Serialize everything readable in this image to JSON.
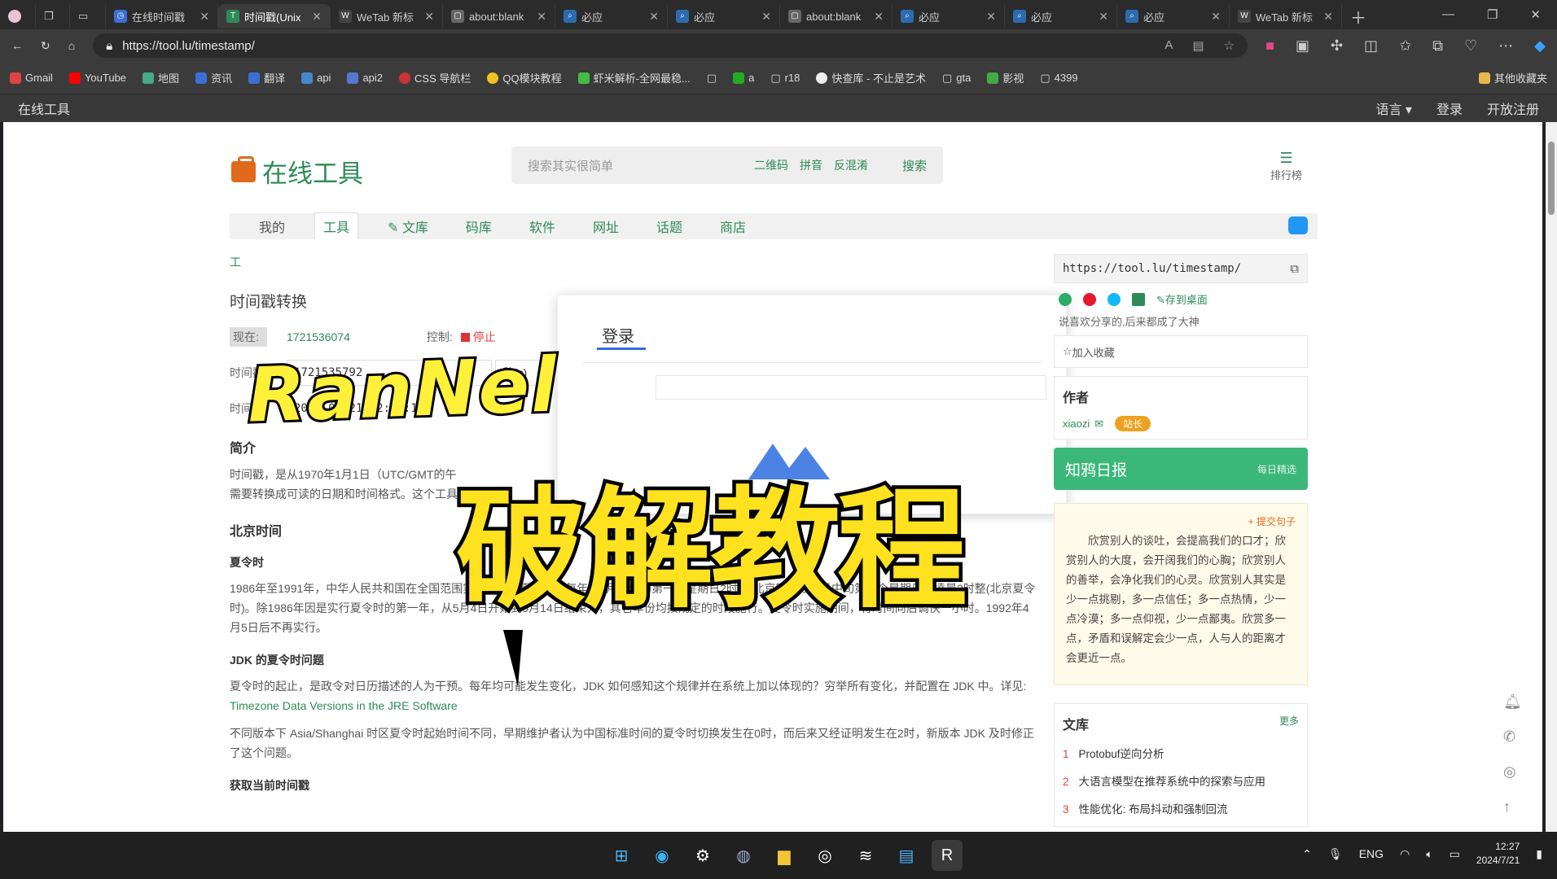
{
  "tabs": [
    {
      "label": "在线时间戳",
      "active": false
    },
    {
      "label": "时间戳(Unix",
      "active": true
    },
    {
      "label": "WeTab 新标",
      "active": false
    },
    {
      "label": "about:blank",
      "active": false
    },
    {
      "label": "必应",
      "active": false
    },
    {
      "label": "必应",
      "active": false
    },
    {
      "label": "about:blank",
      "active": false
    },
    {
      "label": "必应",
      "active": false
    },
    {
      "label": "必应",
      "active": false
    },
    {
      "label": "必应",
      "active": false
    },
    {
      "label": "WeTab 新标",
      "active": false
    }
  ],
  "address": {
    "url": "https://tool.lu/timestamp/"
  },
  "bookmarks": [
    "Gmail",
    "YouTube",
    "地图",
    "资讯",
    "翻译",
    "api",
    "api2",
    "CSS 导航栏",
    "QQ模块教程",
    "虾米解析-全网最稳...",
    "",
    "a",
    "r18",
    "快查库 - 不止是艺术",
    "gta",
    "影视",
    "4399",
    "其他收藏夹"
  ],
  "sitebar": {
    "left": "在线工具",
    "language": "语言 ▾",
    "login": "登录",
    "register": "开放注册"
  },
  "header": {
    "logo": "在线工具",
    "search_placeholder": "搜索其实很简单",
    "search_tags": [
      "二维码",
      "拼音",
      "反混淆"
    ],
    "search_button": "搜索",
    "rank": "排行榜"
  },
  "nav": [
    "我的",
    "工具",
    "文库",
    "码库",
    "软件",
    "网址",
    "话题",
    "商店"
  ],
  "main": {
    "breadcrumb": "工",
    "title": "时间戳转换",
    "now_label": "现在:",
    "now_value": "1721536074",
    "control_label": "控制:",
    "stop_label": "停止",
    "ts_label": "时间戳",
    "ts_value": "1721535792",
    "unit": "秒(s)",
    "time_label": "时间",
    "time_value": "2024-07-21 12:23:12",
    "intro_h": "简介",
    "intro_p": "时间戳，是从1970年1月1日（UTC/GMT的午",
    "intro_p2": "需要转换成可读的日期和时间格式。这个工具",
    "beijing_h": "北京时间",
    "dst_h": "夏令时",
    "dst_p": "1986年至1991年，中华人民共和国在全国范围实行了六年夏令时，每年从4月中旬的第一个星期日2时整(北京时间)到9月中旬第一个星期日的凌晨2时整(北京夏令时)。除1986年因是实行夏令时的第一年，从5月4日开始到9月14日结束外，其它年份均按规定的时段施行。夏令时实施期间，将时间向后调快一小时。1992年4月5日后不再实行。",
    "jdk_h": "JDK 的夏令时问题",
    "jdk_p": "夏令时的起止，是政令对日历描述的人为干预。每年均可能发生变化，JDK 如何感知这个规律并在系统上加以体现的？穷举所有变化，并配置在 JDK 中。详见:",
    "jdk_link": "Timezone Data Versions in the JRE Software",
    "jdk_p2": "不同版本下 Asia/Shanghai 时区夏令时起始时间不同，早期维护者认为中国标准时间的夏令时切换发生在0时，而后来又经证明发生在2时，新版本 JDK 及时修正了这个问题。",
    "get_h": "获取当前时间戳"
  },
  "dialog": {
    "title": "登录"
  },
  "overlay": {
    "brand": "RanNel",
    "headline": "破解教程"
  },
  "sidebar": {
    "url": "https://tool.lu/timestamp/",
    "save_desktop": "存到桌面",
    "share_tip": "说喜欢分享的,后来都成了大神",
    "favorite": "加入收藏",
    "author_h": "作者",
    "author_name": "xiaozi",
    "author_badge": "站长",
    "zhihu": "知鸦日报",
    "zhihu_sub": "每日精选",
    "quote_add": "+ 提交句子",
    "quote": "欣赏别人的谈吐，会提高我们的口才；欣赏别人的大度，会开阔我们的心胸；欣赏别人的善举，会净化我们的心灵。欣赏别人其实是少一点挑剔，多一点信任；多一点热情，少一点冷漠；多一点仰视，少一点鄙夷。欣赏多一点，矛盾和误解定会少一点，人与人的距离才会更近一点。",
    "lib_h": "文库",
    "lib_more": "更多",
    "lib_items": [
      "Protobuf逆向分析",
      "大语言模型在推荐系统中的探索与应用",
      "性能优化: 布局抖动和强制回流"
    ]
  },
  "taskbar": {
    "lang": "ENG",
    "time": "12:27",
    "date": "2024/7/21"
  }
}
